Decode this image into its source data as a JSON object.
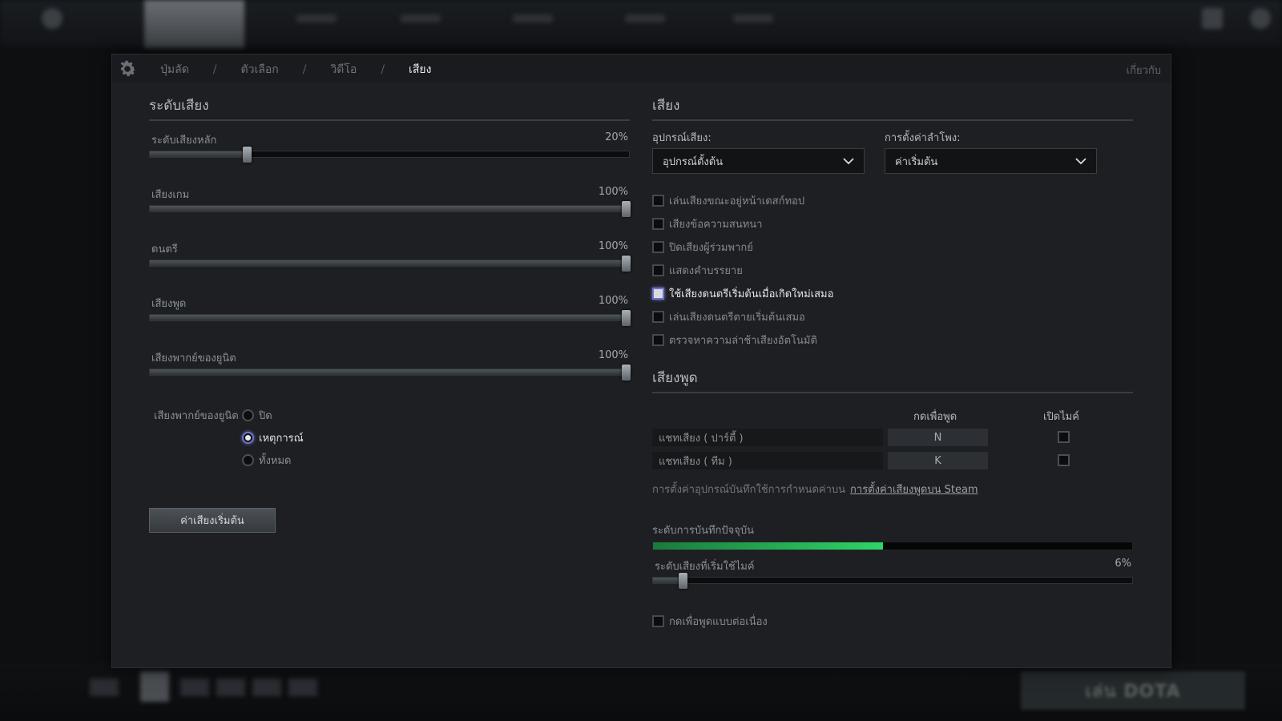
{
  "breadcrumb": {
    "items": [
      {
        "label": "ปุ่มลัด",
        "active": false
      },
      {
        "label": "ตัวเลือก",
        "active": false
      },
      {
        "label": "วิดีโอ",
        "active": false
      },
      {
        "label": "เสียง",
        "active": true
      }
    ],
    "separator": "/",
    "about": "เกี่ยวกับ"
  },
  "volume": {
    "title": "ระดับเสียง",
    "sliders": [
      {
        "label": "ระดับเสียงหลัก",
        "value": "20%",
        "level": 0.2
      },
      {
        "label": "เสียงเกม",
        "value": "100%",
        "level": 1.0
      },
      {
        "label": "ดนตรี",
        "value": "100%",
        "level": 1.0
      },
      {
        "label": "เสียงพูด",
        "value": "100%",
        "level": 1.0
      },
      {
        "label": "เสียงพากย์ของยูนิต",
        "value": "100%",
        "level": 1.0
      }
    ],
    "announcer": {
      "label": "เสียงพากย์ของยูนิต",
      "options": [
        {
          "label": "ปิด",
          "checked": false
        },
        {
          "label": "เหตุการณ์",
          "checked": true
        },
        {
          "label": "ทั้งหมด",
          "checked": false
        }
      ]
    },
    "reset_button": "ค่าเสียงเริ่มต้น"
  },
  "audio": {
    "title": "เสียง",
    "device_label": "อุปกรณ์เสียง:",
    "device_value": "อุปกรณ์ตั้งต้น",
    "speaker_label": "การตั้งค่าลำโพง:",
    "speaker_value": "ค่าเริ่มต้น",
    "checkboxes": [
      {
        "label": "เล่นเสียงขณะอยู่หน้าเดสก์ทอป",
        "checked": false,
        "focused": false
      },
      {
        "label": "เสียงข้อความสนทนา",
        "checked": false,
        "focused": false
      },
      {
        "label": "ปิดเสียงผู้ร่วมพากย์",
        "checked": false,
        "focused": false
      },
      {
        "label": "แสดงคำบรรยาย",
        "checked": false,
        "focused": false
      },
      {
        "label": "ใช้เสียงดนตรีเริ่มต้นเมื่อเกิดใหม่เสมอ",
        "checked": false,
        "focused": true
      },
      {
        "label": "เล่นเสียงดนตรีตายเริ่มต้นเสมอ",
        "checked": false,
        "focused": false
      },
      {
        "label": "ตรวจหาความล่าช้าเสียงอัตโนมัติ",
        "checked": false,
        "focused": false
      }
    ]
  },
  "voice": {
    "title": "เสียงพูด",
    "col_ptt": "กดเพื่อพูด",
    "col_mic": "เปิดไมค์",
    "rows": [
      {
        "name": "แชทเสียง ( ปาร์ตี้ )",
        "key": "N",
        "open_mic": false
      },
      {
        "name": "แชทเสียง ( ทีม )",
        "key": "K",
        "open_mic": false
      }
    ],
    "note": "การตั้งค่าอุปกรณ์บันทึกใช้การกำหนดค่าบน",
    "note_link": "การตั้งค่าเสียงพูดบน Steam",
    "recording_label": "ระดับการบันทึกปัจจุบัน",
    "recording_level": 0.48,
    "threshold_label": "ระดับเสียงที่เริ่มใช้ไมค์",
    "threshold_value": "6%",
    "threshold_level": 0.06,
    "continuous_label": "กดเพื่อพูดแบบต่อเนื่อง",
    "continuous_checked": false
  },
  "background": {
    "play_button": "เล่น DOTA"
  },
  "colors": {
    "accent_focus": "#7073c9",
    "recording_green": "#2fd566"
  }
}
